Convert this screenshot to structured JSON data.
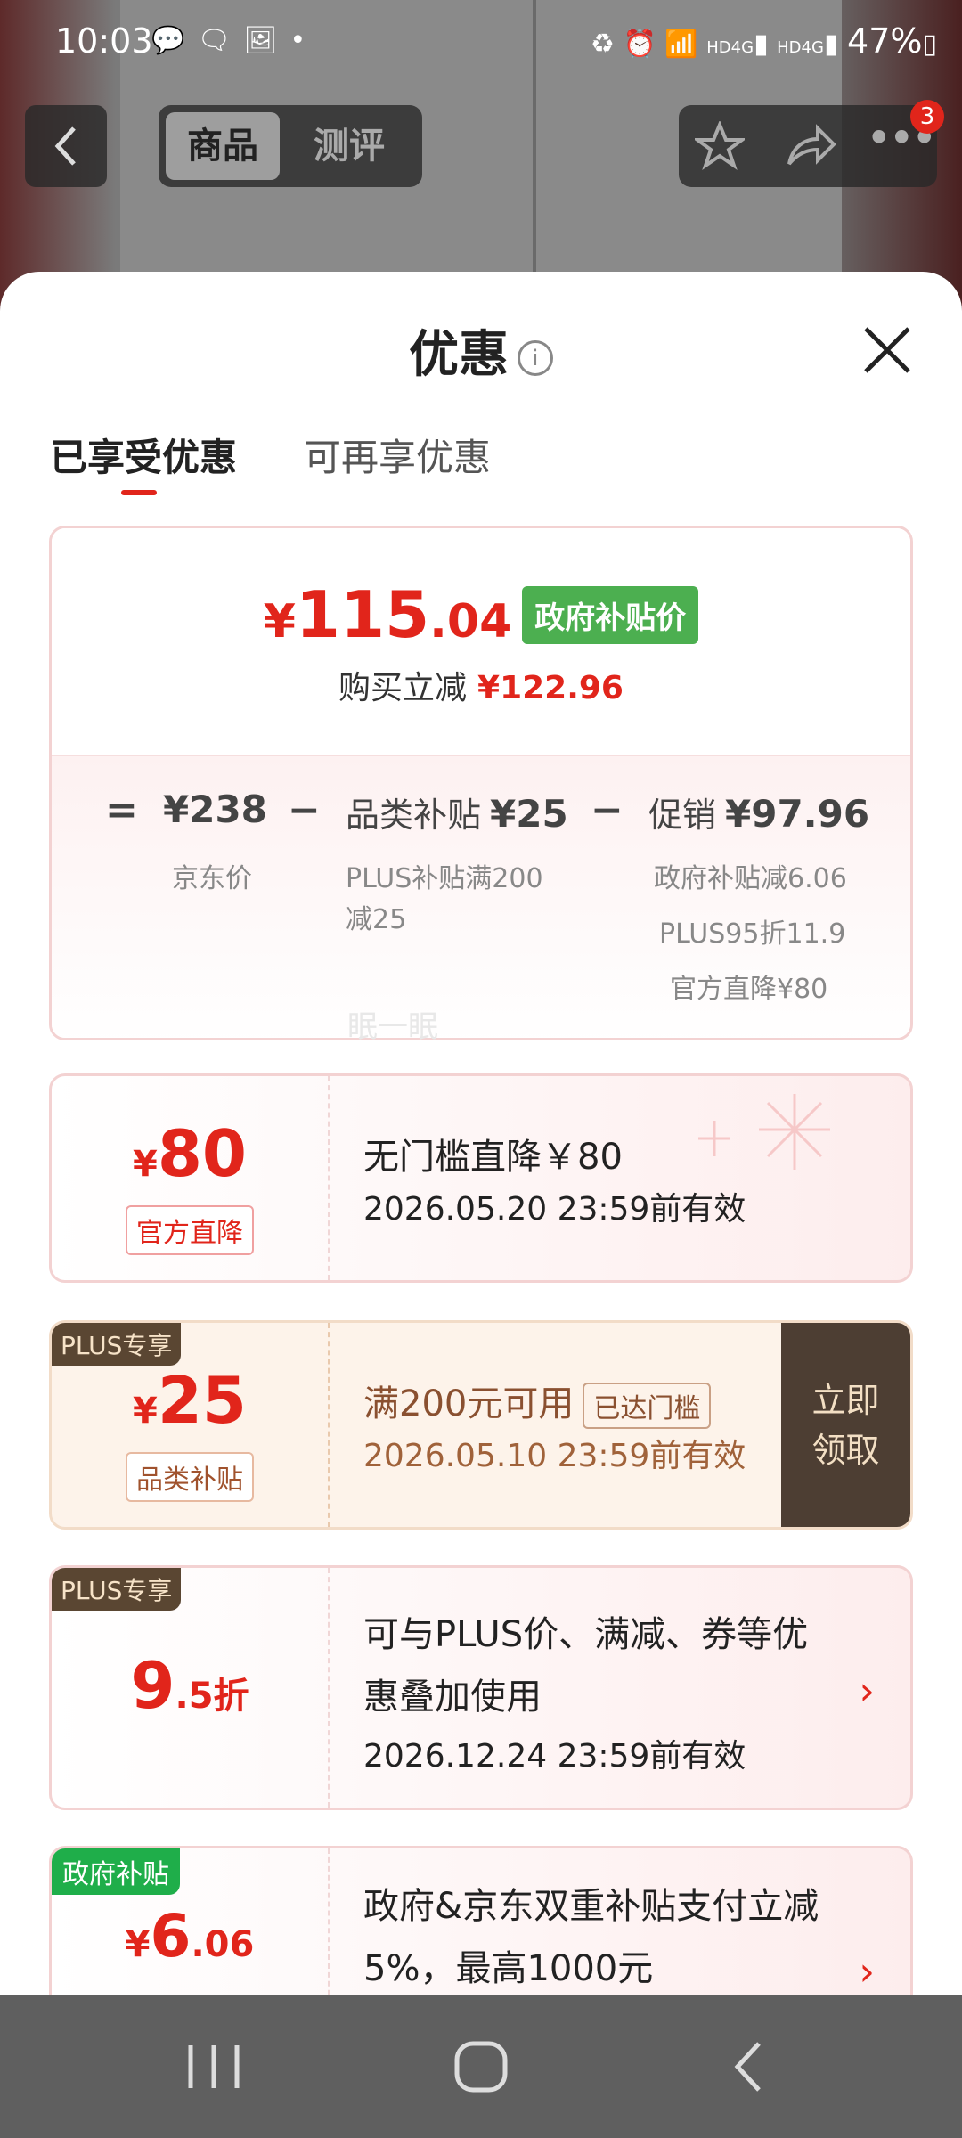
{
  "status_bar": {
    "time": "10:03",
    "left_icons": [
      "message-icon",
      "wechat-icon",
      "gallery-icon",
      "dot-icon"
    ],
    "right_icons": [
      "battery-saver-icon",
      "alarm-icon",
      "wifi-icon",
      "signal-icon",
      "signal-icon"
    ],
    "net1": "HD",
    "net2": "4G",
    "net3": "HD",
    "net4": "4G",
    "battery": "47%"
  },
  "top_nav": {
    "tabs": [
      "商品",
      "测评"
    ],
    "badge": "3"
  },
  "sheet": {
    "title": "优惠",
    "info": "i",
    "tabs": [
      "已享受优惠",
      "可再享优惠"
    ]
  },
  "summary": {
    "price_symbol": "¥",
    "price_int": "115",
    "price_dec": ".04",
    "price_tag": "政府补贴价",
    "reduce_label": "购买立减",
    "reduce_amount": "¥122.96",
    "eq": "=",
    "minus": "−",
    "jd_price": "¥238",
    "jd_label": "京东价",
    "cat_label": "品类补贴",
    "cat_value": "¥25",
    "cat_sub1": "PLUS补贴满200",
    "cat_sub2": "减25",
    "promo_label": "促销",
    "promo_value": "¥97.96",
    "promo_sub1": "政府补贴减6.06",
    "promo_sub2": "PLUS95折11.9",
    "promo_sub3": "官方直降¥80"
  },
  "watermark": "眠一眠",
  "coupons": [
    {
      "amount_symbol": "¥",
      "amount": "80",
      "chip": "官方直降",
      "title": "无门槛直降￥80",
      "date": "2026.05.20 23:59前有效"
    },
    {
      "tag": "PLUS专享",
      "amount_symbol": "¥",
      "amount": "25",
      "chip": "品类补贴",
      "title": "满200元可用",
      "status": "已达门槛",
      "date": "2026.05.10 23:59前有效",
      "action_line1": "立即",
      "action_line2": "领取"
    },
    {
      "tag": "PLUS专享",
      "amount": "9",
      "amount_dec": ".5折",
      "title": "可与PLUS价、满减、券等优惠叠加使用",
      "date": "2026.12.24 23:59前有效"
    },
    {
      "tag": "政府补贴",
      "amount_symbol": "¥",
      "amount": "6",
      "amount_dec": ".06",
      "title": "政府&京东双重补贴支付立减5%，最高1000元"
    }
  ],
  "colors": {
    "accent": "#e1251b",
    "gov_green": "#4caf50",
    "plus_brown": "#5a4632"
  }
}
